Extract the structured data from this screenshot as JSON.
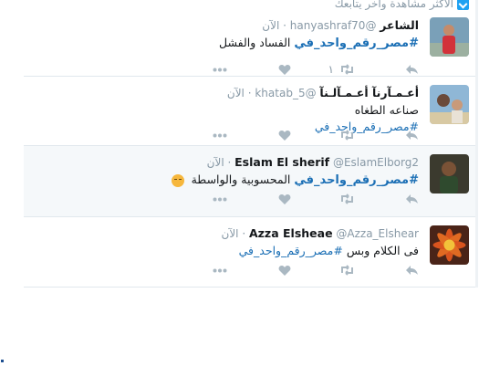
{
  "header": {
    "label": "الأكثر مشاهدة وآخر يتابعك"
  },
  "tweets": [
    {
      "name": "الشاعر",
      "handle": "@hanyashraf70",
      "time": "الآن",
      "hashtag": "#مصر_رقم_واحد_في",
      "text": "الفساد والفشل",
      "retweets": "١",
      "avatar_bg": "#7aa0b8"
    },
    {
      "name": "أعـمـآرنآ أعـمـآلـنآ",
      "handle": "@khatab_5",
      "time": "الآن",
      "hashtag": "#مصر_رقم_واحد_في",
      "text": "صناعه الطغاه",
      "retweets": "",
      "avatar_bg": "#8fb7d6"
    },
    {
      "name": "Eslam El sherif",
      "handle": "@EslamElborg2",
      "time": "الآن",
      "hashtag": "#مصر_رقم_واحد_في",
      "text": "المحسوبية والواسطة",
      "retweets": "",
      "avatar_bg": "#3b3a2e"
    },
    {
      "name": "Azza Elsheae",
      "handle": "@Azza_Elshear",
      "time": "الآن",
      "hashtag": "#مصر_رقم_واحد_في",
      "text": "فى الكلام وبس",
      "retweets": "",
      "avatar_bg": "#c2401e"
    }
  ],
  "icons": {
    "reply": "reply-icon",
    "retweet": "retweet-icon",
    "like": "heart-icon",
    "more": "more-icon"
  },
  "colors": {
    "hashtag": "#1b6fb5",
    "muted": "#8899a6",
    "highlight": "#f5f8fa",
    "divider": "#e1e8ed"
  }
}
